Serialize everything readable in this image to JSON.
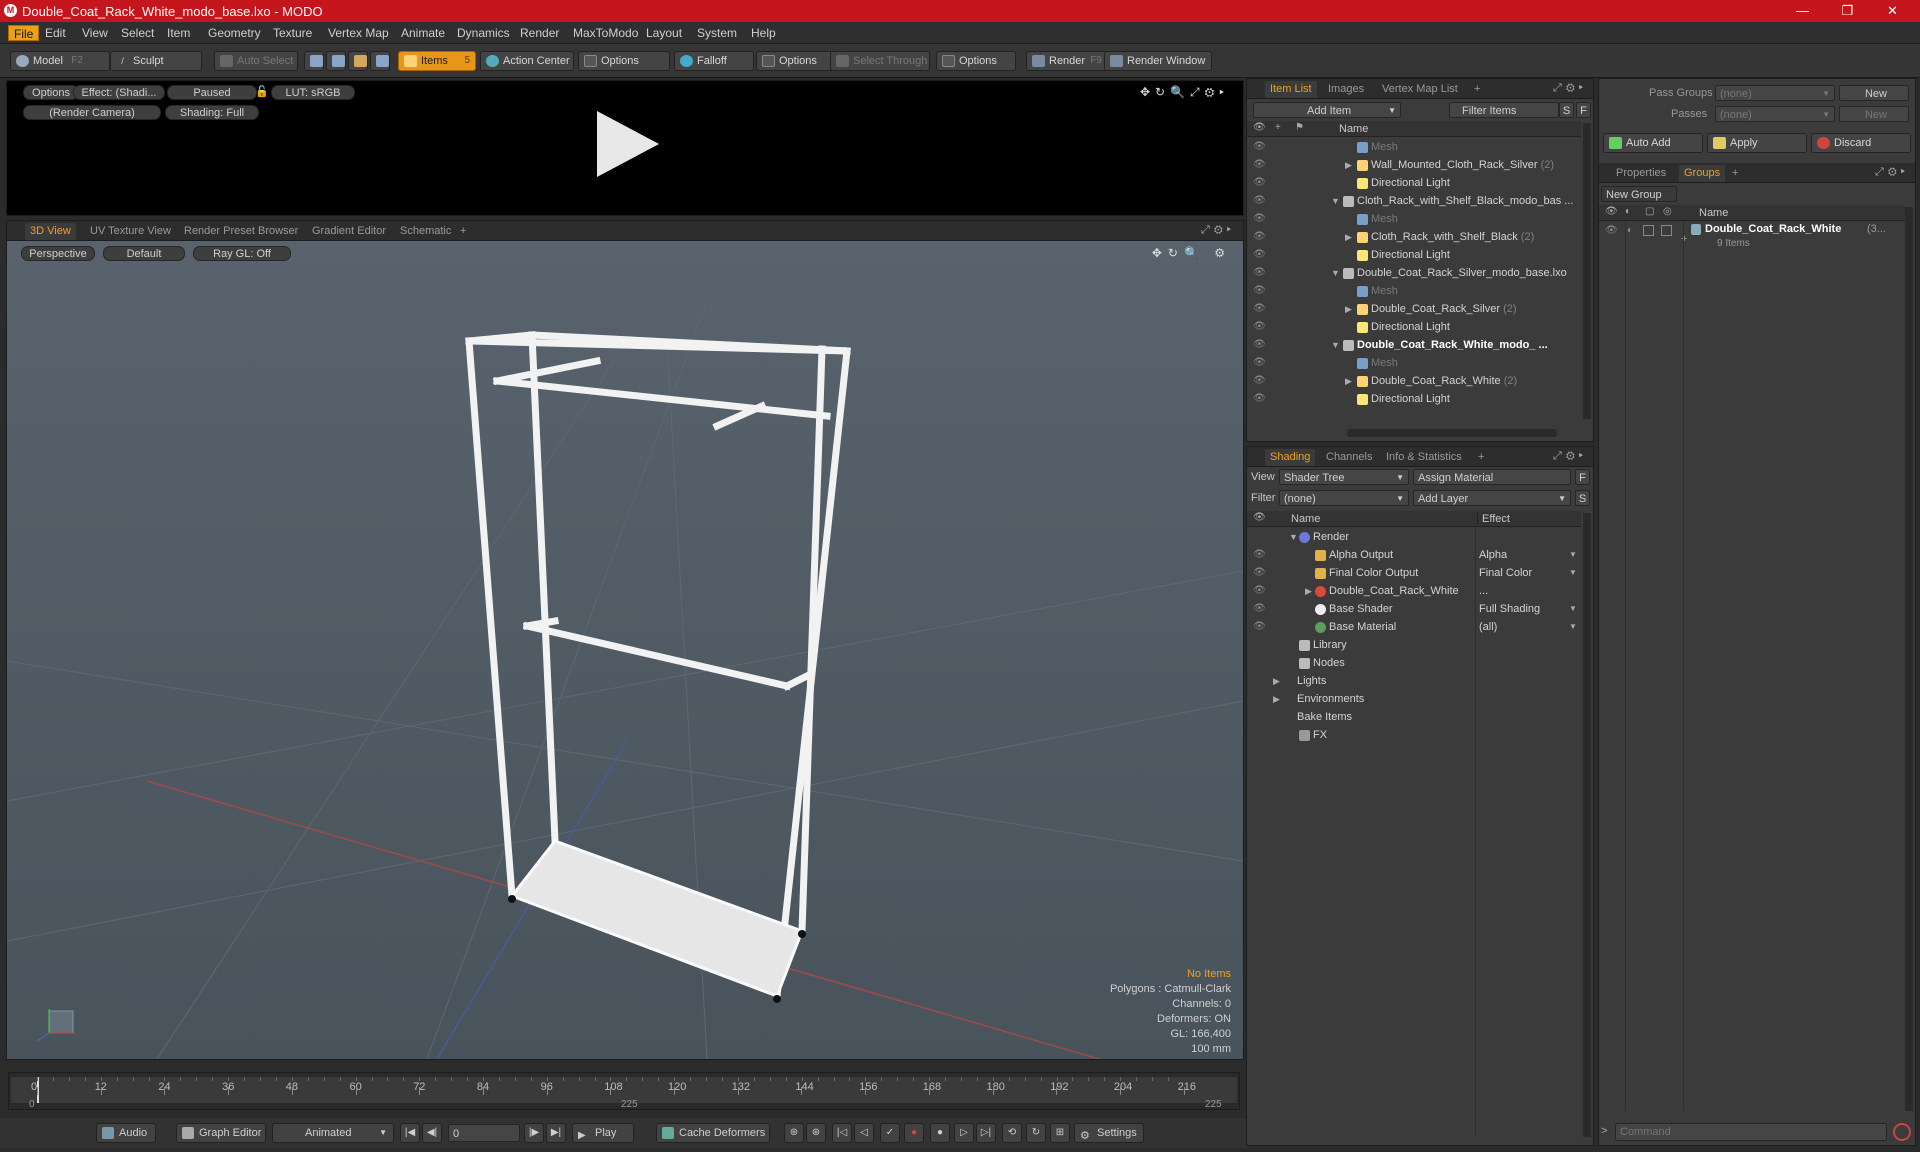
{
  "window": {
    "title": "Double_Coat_Rack_White_modo_base.lxo - MODO",
    "app_icon": "M",
    "controls": [
      "—",
      "❐",
      "✕"
    ]
  },
  "menu": [
    "File",
    "Edit",
    "View",
    "Select",
    "Item",
    "Geometry",
    "Texture",
    "Vertex Map",
    "Animate",
    "Dynamics",
    "Render",
    "MaxToModo",
    "Layout",
    "System",
    "Help"
  ],
  "toolbar": {
    "model": "Model",
    "model_key": "F2",
    "sculpt": "Sculpt",
    "auto_select": "Auto Select",
    "items": "Items",
    "items_key": "5",
    "action_center": "Action Center",
    "options1": "Options",
    "falloff": "Falloff",
    "options2": "Options",
    "select_through": "Select Through",
    "options3": "Options",
    "render": "Render",
    "render_key": "F9",
    "render_window": "Render Window"
  },
  "render_preview": {
    "options": "Options",
    "effect": "Effect: (Shadi...",
    "paused": "Paused",
    "lut": "LUT: sRGB",
    "camera": "(Render Camera)",
    "shading": "Shading: Full"
  },
  "viewport": {
    "tabs": [
      "3D View",
      "UV Texture View",
      "Render Preset Browser",
      "Gradient Editor",
      "Schematic",
      "+"
    ],
    "perspective": "Perspective",
    "default": "Default",
    "raygl": "Ray GL: Off",
    "stats": {
      "no_items": "No Items",
      "polygons": "Polygons : Catmull-Clark",
      "channels": "Channels: 0",
      "deformers": "Deformers: ON",
      "gl": "GL: 166,400",
      "units": "100 mm"
    }
  },
  "item_list": {
    "tabs": [
      "Item List",
      "Images",
      "Vertex Map List",
      "+"
    ],
    "add_item": "Add Item",
    "filter_items": "Filter Items",
    "s": "S",
    "f": "F",
    "col_name": "Name",
    "rows": [
      {
        "label": "Mesh",
        "count": ""
      },
      {
        "label": "Wall_Mounted_Cloth_Rack_Silver",
        "count": "(2)"
      },
      {
        "label": "Directional Light",
        "count": ""
      },
      {
        "label": "Cloth_Rack_with_Shelf_Black_modo_bas ...",
        "count": ""
      },
      {
        "label": "Mesh",
        "count": ""
      },
      {
        "label": "Cloth_Rack_with_Shelf_Black",
        "count": "(2)"
      },
      {
        "label": "Directional Light",
        "count": ""
      },
      {
        "label": "Double_Coat_Rack_Silver_modo_base.lxo",
        "count": ""
      },
      {
        "label": "Mesh",
        "count": ""
      },
      {
        "label": "Double_Coat_Rack_Silver",
        "count": "(2)"
      },
      {
        "label": "Directional Light",
        "count": ""
      },
      {
        "label": "Double_Coat_Rack_White_modo_ ...",
        "count": ""
      },
      {
        "label": "Mesh",
        "count": ""
      },
      {
        "label": "Double_Coat_Rack_White",
        "count": "(2)"
      },
      {
        "label": "Directional Light",
        "count": ""
      }
    ]
  },
  "shading": {
    "tabs": [
      "Shading",
      "Channels",
      "Info & Statistics",
      "+"
    ],
    "view_label": "View",
    "view_value": "Shader Tree",
    "assign_material": "Assign Material",
    "filter_label": "Filter",
    "filter_value": "(none)",
    "add_layer": "Add Layer",
    "f": "F",
    "s": "S",
    "col_name": "Name",
    "col_effect": "Effect",
    "rows": [
      {
        "label": "Render",
        "effect": ""
      },
      {
        "label": "Alpha Output",
        "effect": "Alpha"
      },
      {
        "label": "Final Color Output",
        "effect": "Final Color"
      },
      {
        "label": "Double_Coat_Rack_White",
        "effect": "..."
      },
      {
        "label": "Base Shader",
        "effect": "Full Shading"
      },
      {
        "label": "Base Material",
        "effect": "(all)"
      },
      {
        "label": "Library",
        "effect": ""
      },
      {
        "label": "Nodes",
        "effect": ""
      },
      {
        "label": "Lights",
        "effect": ""
      },
      {
        "label": "Environments",
        "effect": ""
      },
      {
        "label": "Bake Items",
        "effect": ""
      },
      {
        "label": "FX",
        "effect": ""
      }
    ]
  },
  "groups_panel": {
    "pass_groups": "Pass Groups",
    "pass_groups_value": "(none)",
    "new": "New",
    "passes": "Passes",
    "passes_value": "(none)",
    "new2": "New",
    "auto_add": "Auto Add",
    "apply": "Apply",
    "discard": "Discard",
    "tabs": [
      "Properties",
      "Groups",
      "+"
    ],
    "new_group": "New Group",
    "col_name": "Name",
    "group_name": "Double_Coat_Rack_White",
    "group_count": "(3...",
    "group_items": "9 Items",
    "command_placeholder": "Command"
  },
  "timeline": {
    "labels": [
      "0",
      "12",
      "24",
      "36",
      "48",
      "60",
      "72",
      "84",
      "96",
      "108",
      "120",
      "132",
      "144",
      "156",
      "168",
      "180",
      "192",
      "204",
      "216"
    ],
    "bottom_labels": [
      "0",
      "225",
      "225"
    ]
  },
  "bottombar": {
    "audio": "Audio",
    "graph_editor": "Graph Editor",
    "animated": "Animated",
    "frame": "0",
    "play": "Play",
    "cache_deformers": "Cache Deformers",
    "settings": "Settings"
  }
}
